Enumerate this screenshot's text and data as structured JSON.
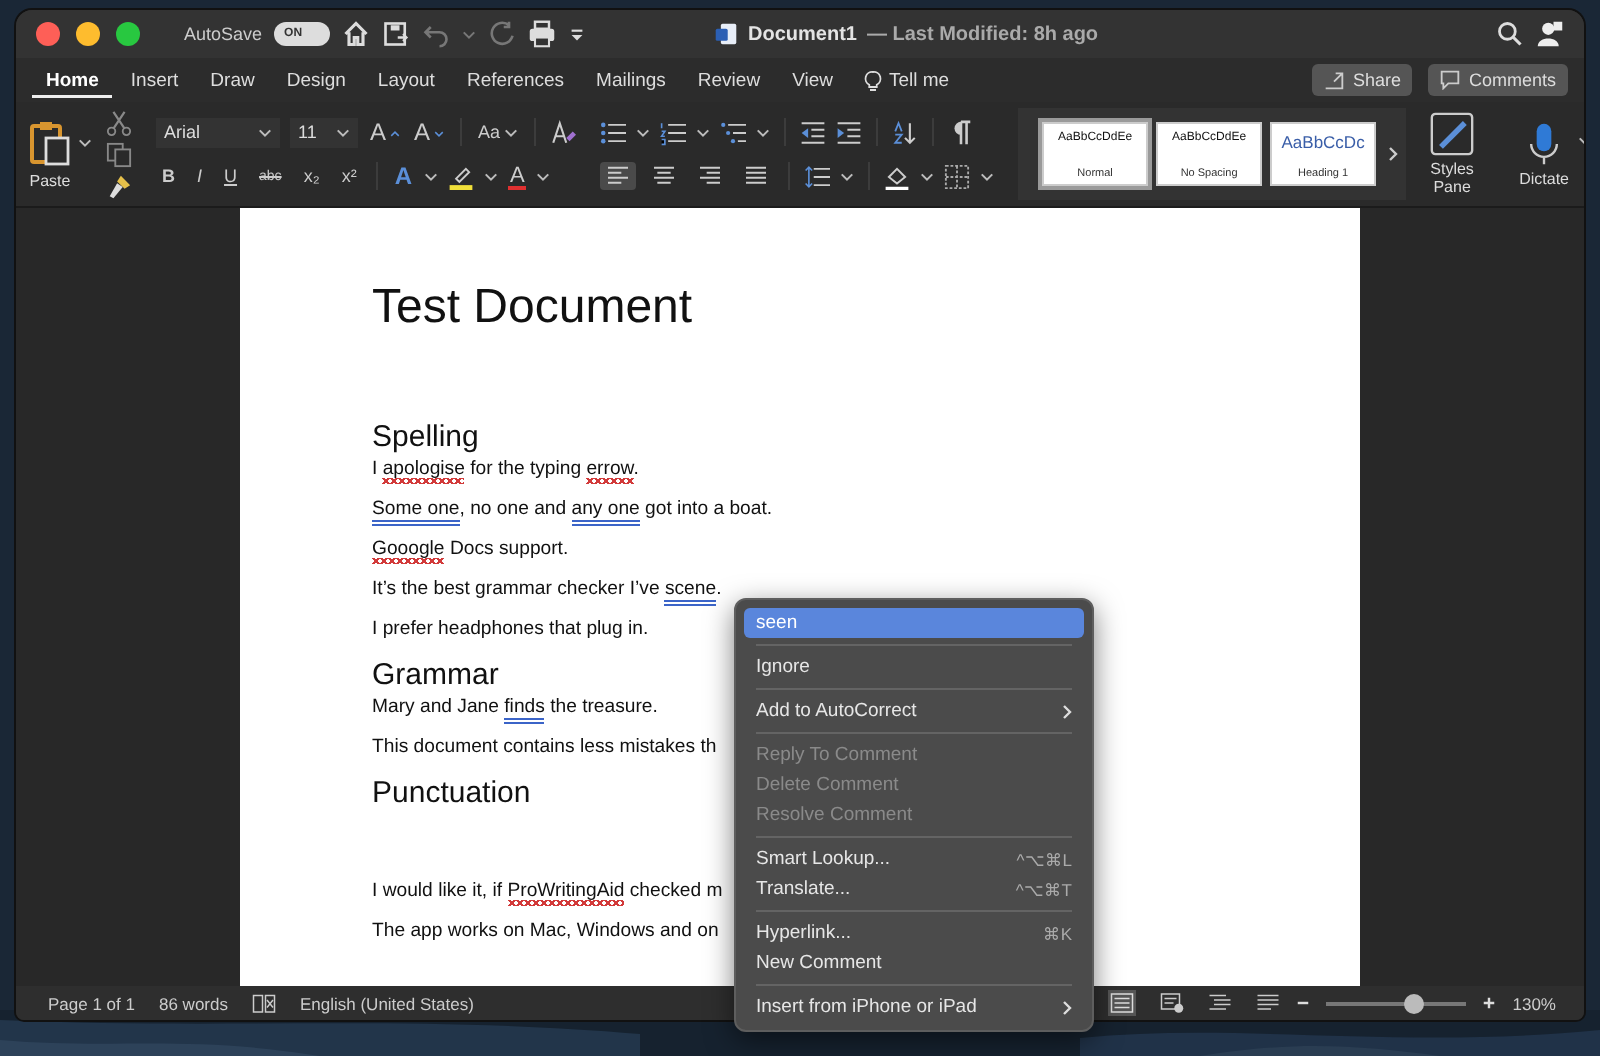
{
  "window": {
    "title": "Document1",
    "subtitle": "— Last Modified: 8h ago"
  },
  "title_bar": {
    "autosave_label": "AutoSave",
    "autosave": {
      "on": true,
      "label": "ON"
    }
  },
  "tabs": [
    {
      "label": "Home",
      "selected": true
    },
    {
      "label": "Insert",
      "selected": false
    },
    {
      "label": "Draw",
      "selected": false
    },
    {
      "label": "Design",
      "selected": false
    },
    {
      "label": "Layout",
      "selected": false
    },
    {
      "label": "References",
      "selected": false
    },
    {
      "label": "Mailings",
      "selected": false
    },
    {
      "label": "Review",
      "selected": false
    },
    {
      "label": "View",
      "selected": false
    }
  ],
  "tell_me": "Tell me",
  "share_button": "Share",
  "comments_button": "Comments",
  "ribbon": {
    "paste": "Paste",
    "font": "Arial",
    "size": "11",
    "grow": "A",
    "shrink": "A",
    "case_button": "Aa",
    "format_buttons": [
      "B",
      "I",
      "U",
      "abc",
      "x₂",
      "x²"
    ],
    "effects": "A",
    "font_color": "A",
    "alignments": [
      {
        "selected": true
      },
      {
        "selected": false
      },
      {
        "selected": false
      },
      {
        "selected": false
      }
    ],
    "styles": [
      {
        "preview": "AaBbCcDdEe",
        "name": "Normal",
        "selected": true,
        "kind": "body"
      },
      {
        "preview": "AaBbCcDdEe",
        "name": "No Spacing",
        "selected": false,
        "kind": "body"
      },
      {
        "preview": "AaBbCcDc",
        "name": "Heading 1",
        "selected": false,
        "kind": "heading"
      }
    ],
    "styles_pane": "Styles Pane",
    "dictate": "Dictate"
  },
  "document": {
    "blocks": [
      {
        "kind": "title",
        "text": "Test Document"
      },
      {
        "kind": "heading",
        "text": "Spelling"
      },
      {
        "kind": "para",
        "segments": [
          {
            "text": "I ",
            "spelling_error": false,
            "grammar_error": false
          },
          {
            "text": "apologise",
            "spelling_error": true,
            "grammar_error": false
          },
          {
            "text": " for the typing ",
            "spelling_error": false,
            "grammar_error": false
          },
          {
            "text": "errow",
            "spelling_error": true,
            "grammar_error": false
          },
          {
            "text": ".",
            "spelling_error": false,
            "grammar_error": false
          }
        ]
      },
      {
        "kind": "para",
        "segments": [
          {
            "text": "Some one",
            "spelling_error": false,
            "grammar_error": true
          },
          {
            "text": ", no one and ",
            "spelling_error": false,
            "grammar_error": false
          },
          {
            "text": "any one",
            "spelling_error": false,
            "grammar_error": true
          },
          {
            "text": " got into a boat.",
            "spelling_error": false,
            "grammar_error": false
          }
        ]
      },
      {
        "kind": "para",
        "segments": [
          {
            "text": "Gooogle",
            "spelling_error": true,
            "grammar_error": false
          },
          {
            "text": " Docs support.",
            "spelling_error": false,
            "grammar_error": false
          }
        ]
      },
      {
        "kind": "para",
        "segments": [
          {
            "text": "It’s the best grammar checker I’ve ",
            "spelling_error": false,
            "grammar_error": false
          },
          {
            "text": "scene",
            "spelling_error": false,
            "grammar_error": true
          },
          {
            "text": ".",
            "spelling_error": false,
            "grammar_error": false
          }
        ]
      },
      {
        "kind": "para",
        "segments": [
          {
            "text": "I prefer headphones that plug in.",
            "spelling_error": false,
            "grammar_error": false
          }
        ]
      },
      {
        "kind": "heading",
        "text": "Grammar"
      },
      {
        "kind": "para",
        "segments": [
          {
            "text": "Mary and Jane ",
            "spelling_error": false,
            "grammar_error": false
          },
          {
            "text": "finds",
            "spelling_error": false,
            "grammar_error": true
          },
          {
            "text": " the treasure.",
            "spelling_error": false,
            "grammar_error": false
          }
        ]
      },
      {
        "kind": "para",
        "segments": [
          {
            "text": "This document contains less mistakes th",
            "spelling_error": false,
            "grammar_error": false
          }
        ]
      },
      {
        "kind": "heading",
        "text": "Punctuation"
      },
      {
        "kind": "empty"
      },
      {
        "kind": "para",
        "segments": [
          {
            "text": "I would like it, if ",
            "spelling_error": false,
            "grammar_error": false
          },
          {
            "text": "ProWritingAid",
            "spelling_error": true,
            "grammar_error": false
          },
          {
            "text": " checked m",
            "spelling_error": false,
            "grammar_error": false
          }
        ]
      },
      {
        "kind": "para",
        "segments": [
          {
            "text": "The app works on Mac, Windows and on",
            "spelling_error": false,
            "grammar_error": false
          }
        ]
      }
    ]
  },
  "status_bar": {
    "page": "Page 1 of 1",
    "words": "86 words",
    "language": "English (United States)",
    "zoom": {
      "level": 0.62
    },
    "zoom_label": "130%"
  },
  "context_menu": {
    "groups": [
      [
        {
          "label": "seen",
          "selected": true,
          "disabled": false,
          "submenu": false
        }
      ],
      [
        {
          "label": "Ignore",
          "selected": false,
          "disabled": false,
          "submenu": false
        }
      ],
      [
        {
          "label": "Add to AutoCorrect",
          "selected": false,
          "disabled": false,
          "submenu": true
        }
      ],
      [
        {
          "label": "Reply To Comment",
          "selected": false,
          "disabled": true,
          "submenu": false
        },
        {
          "label": "Delete Comment",
          "selected": false,
          "disabled": true,
          "submenu": false
        },
        {
          "label": "Resolve Comment",
          "selected": false,
          "disabled": true,
          "submenu": false
        }
      ],
      [
        {
          "label": "Smart Lookup...",
          "shortcut": "^⌥⌘L",
          "selected": false,
          "disabled": false,
          "submenu": false
        },
        {
          "label": "Translate...",
          "shortcut": "^⌥⌘T",
          "selected": false,
          "disabled": false,
          "submenu": false
        }
      ],
      [
        {
          "label": "Hyperlink...",
          "shortcut": "⌘K",
          "selected": false,
          "disabled": false,
          "submenu": false
        },
        {
          "label": "New Comment",
          "selected": false,
          "disabled": false,
          "submenu": false
        }
      ],
      [
        {
          "label": "Insert from iPhone or iPad",
          "selected": false,
          "disabled": false,
          "submenu": true
        }
      ]
    ]
  }
}
